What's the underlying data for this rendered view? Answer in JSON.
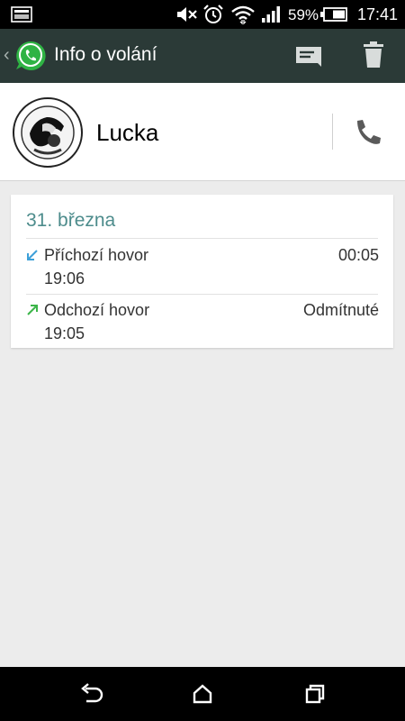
{
  "status_bar": {
    "battery_percent": "59%",
    "time": "17:41",
    "icons": [
      "screenshot-icon",
      "mute-icon",
      "alarm-icon",
      "wifi-icon",
      "signal-icon",
      "battery-icon"
    ]
  },
  "action_bar": {
    "title": "Info o volání",
    "icons": [
      "back-chevron-icon",
      "whatsapp-logo-icon",
      "message-icon",
      "trash-icon"
    ]
  },
  "contact": {
    "name": "Lucka",
    "avatar_text": "REMEMBER THE SPIRIT OF SIXTYNINE",
    "icons": [
      "phone-icon"
    ]
  },
  "call_log": {
    "date": "31. března",
    "calls": [
      {
        "type": "Příchozí hovor",
        "time": "19:06",
        "detail": "00:05",
        "direction": "incoming",
        "arrow_color": "#3ea0d8"
      },
      {
        "type": "Odchozí hovor",
        "time": "19:05",
        "detail": "Odmítnuté",
        "direction": "outgoing",
        "arrow_color": "#3cb54a"
      }
    ]
  },
  "nav_bar": {
    "icons": [
      "back-icon",
      "home-icon",
      "recents-icon"
    ]
  },
  "colors": {
    "action_bar": "#2b3a37",
    "date_text": "#4d8c8c",
    "background": "#ececec",
    "whatsapp_green": "#2fb344"
  }
}
